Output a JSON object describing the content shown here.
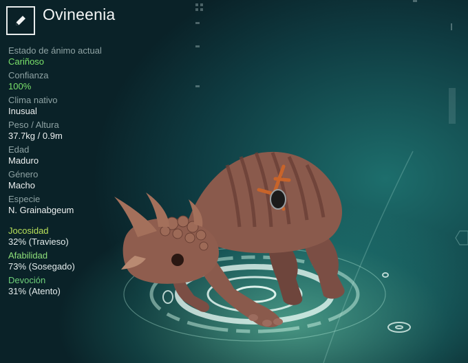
{
  "creature": {
    "name": "Ovineenia"
  },
  "stats": [
    {
      "label": "Estado de ánimo actual",
      "value": "Cariñoso"
    },
    {
      "label": "Confianza",
      "value": "100%"
    },
    {
      "label": "Clima nativo",
      "value": "Inusual"
    },
    {
      "label": "Peso / Altura",
      "value": "37.7kg / 0.9m"
    },
    {
      "label": "Edad",
      "value": "Maduro"
    },
    {
      "label": "Género",
      "value": "Macho"
    },
    {
      "label": "Especie",
      "value": "N. Grainabgeum"
    }
  ],
  "traits": [
    {
      "label": "Jocosidad",
      "value": "32% (Travieso)"
    },
    {
      "label": "Afabilidad",
      "value": "73% (Sosegado)"
    },
    {
      "label": "Devoción",
      "value": "31% (Atento)"
    }
  ],
  "icons": {
    "edit": "pencil-icon"
  }
}
